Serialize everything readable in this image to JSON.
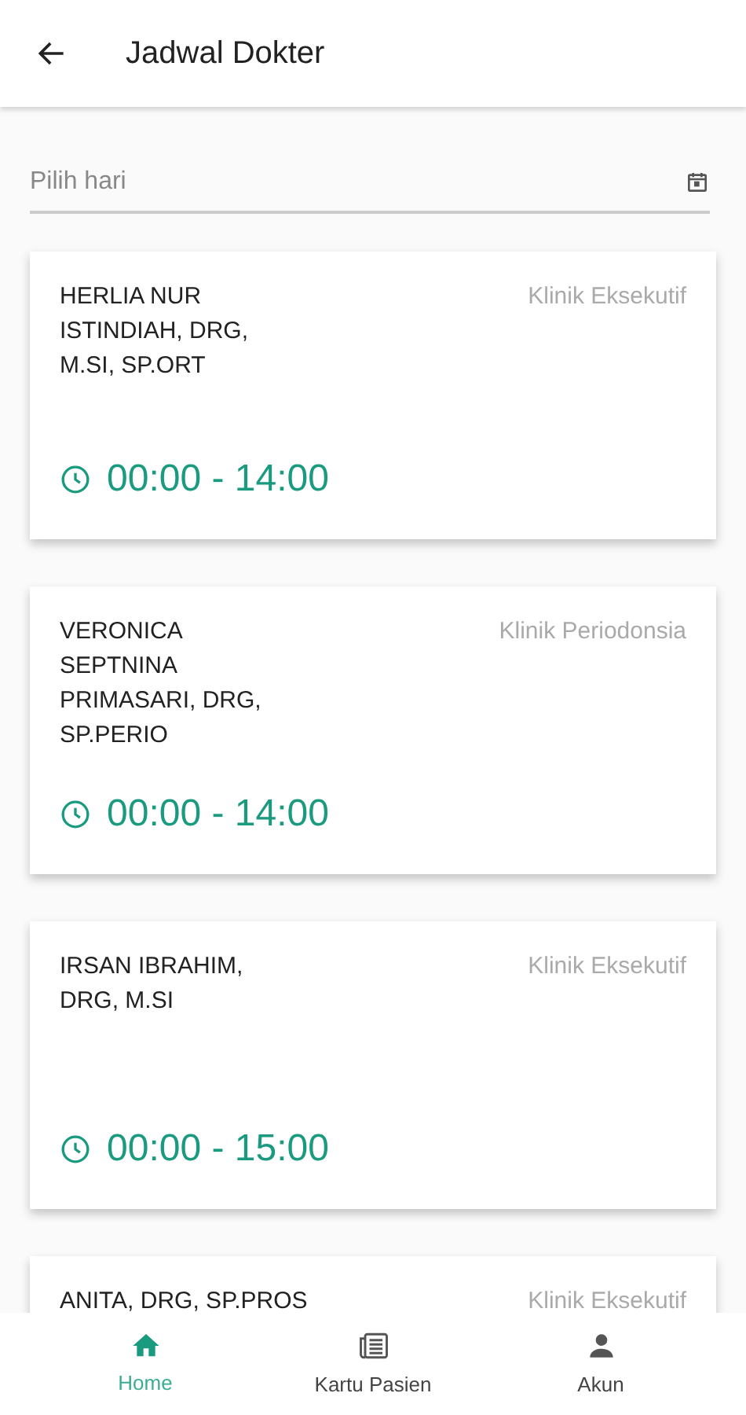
{
  "header": {
    "title": "Jadwal Dokter"
  },
  "day_field": {
    "placeholder": "Pilih hari"
  },
  "doctors": [
    {
      "name_lines": [
        "HERLIA NUR",
        "ISTINDIAH, DRG,",
        "M.SI, SP.ORT"
      ],
      "clinic": "Klinik Eksekutif",
      "time": "00:00 - 14:00"
    },
    {
      "name_lines": [
        "VERONICA",
        "SEPTNINA",
        "PRIMASARI, DRG,",
        "SP.PERIO"
      ],
      "clinic": "Klinik Periodonsia",
      "time": "00:00 - 14:00"
    },
    {
      "name_lines": [
        "IRSAN IBRAHIM,",
        "DRG, M.SI"
      ],
      "clinic": "Klinik Eksekutif",
      "time": "00:00 - 15:00"
    },
    {
      "name_lines": [
        "ANITA, DRG, SP.PROS"
      ],
      "clinic": "Klinik Eksekutif"
    }
  ],
  "nav": [
    {
      "kind": "home",
      "label": "Home",
      "selected": true
    },
    {
      "kind": "card",
      "label": "Kartu Pasien",
      "selected": false
    },
    {
      "kind": "account",
      "label": "Akun",
      "selected": false
    }
  ]
}
